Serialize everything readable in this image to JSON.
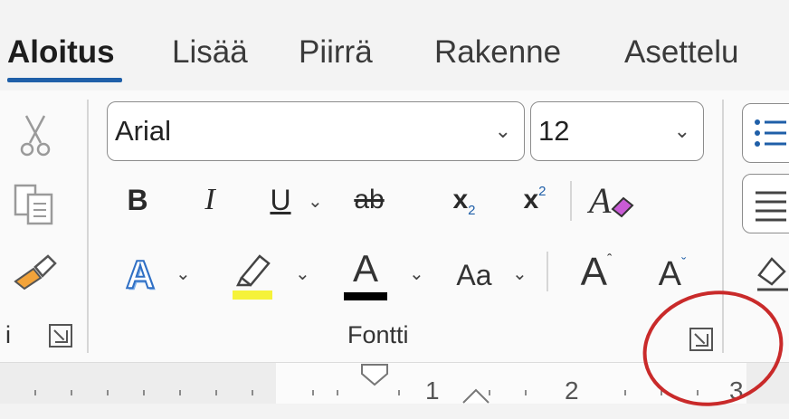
{
  "tabs": [
    {
      "label": "Aloitus",
      "active": true
    },
    {
      "label": "Lisää",
      "active": false
    },
    {
      "label": "Piirrä",
      "active": false
    },
    {
      "label": "Rakenne",
      "active": false
    },
    {
      "label": "Asettelu",
      "active": false
    }
  ],
  "font_group": {
    "label": "Fontti",
    "font_name": "Arial",
    "font_size": "12",
    "bold": "B",
    "italic": "I",
    "underline": "U",
    "strikethrough": "ab",
    "subscript": "x",
    "subscript_mark": "2",
    "superscript": "x",
    "superscript_mark": "2",
    "change_case": "Aa",
    "grow_font": "A",
    "shrink_font": "A",
    "text_effects": "A",
    "font_color": "A",
    "highlight_color": "#f5f23a",
    "font_color_value": "#000000"
  },
  "clipboard_group": {
    "label_fragment": "i"
  },
  "ruler": {
    "numbers": [
      "1",
      "2",
      "3"
    ]
  },
  "annotation": {
    "color": "#c92a2a"
  }
}
